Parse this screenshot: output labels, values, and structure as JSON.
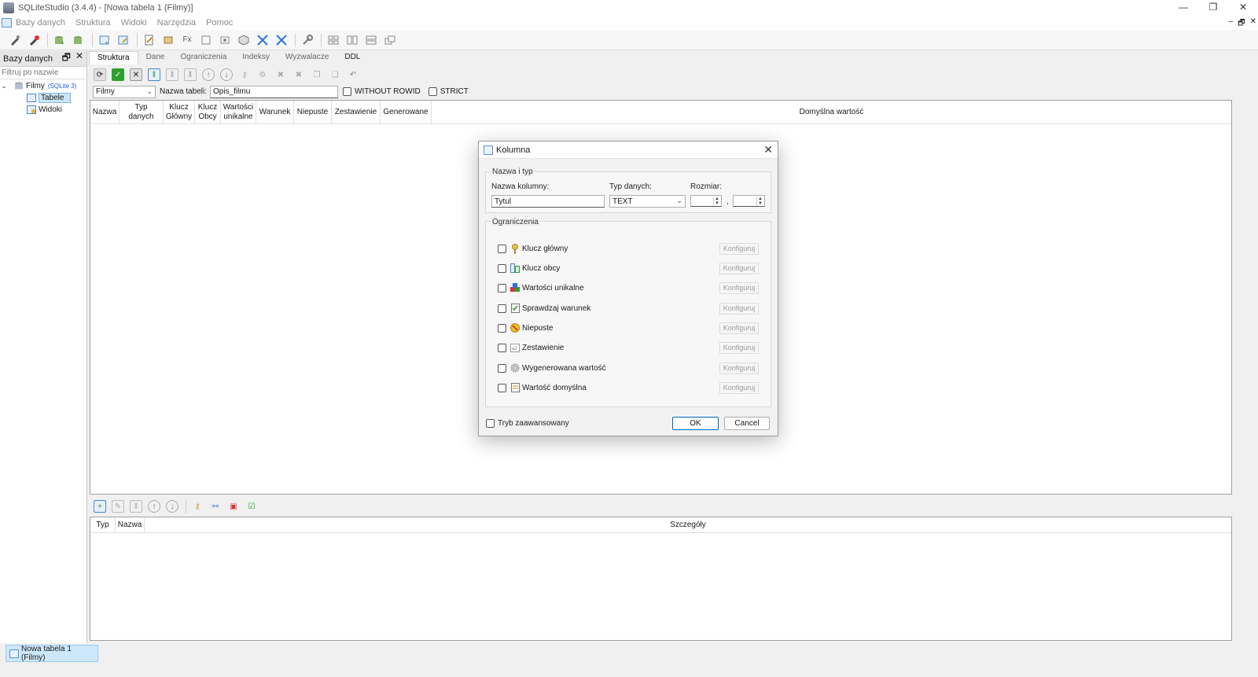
{
  "window": {
    "title": "SQLiteStudio (3.4.4) - [Nowa tabela 1 (Filmy)]",
    "min": "—",
    "max": "❐",
    "close": "✕"
  },
  "menubar": {
    "items": [
      "Bazy danych",
      "Struktura",
      "Widoki",
      "Narzędzia",
      "Pomoc"
    ],
    "mdi_min": "–",
    "mdi_restore": "🗗",
    "mdi_close": "✕"
  },
  "db_panel": {
    "title": "Bazy danych",
    "filter_placeholder": "Filtruj po nazwie",
    "db_name": "Filmy",
    "db_tag": "(SQLite 3)",
    "tables_label": "Tabele",
    "views_label": "Widoki"
  },
  "tabs": [
    "Struktura",
    "Dane",
    "Ograniczenia",
    "Indeksy",
    "Wyzwalacze",
    "DDL"
  ],
  "structure": {
    "db_select": "Filmy",
    "table_name_label": "Nazwa tabeli:",
    "table_name_value": "Opis_filmu",
    "without_rowid": "WITHOUT ROWID",
    "strict": "STRICT"
  },
  "columns_grid": {
    "headers": [
      "Nazwa",
      "Typ danych",
      "Klucz Główny",
      "Klucz Obcy",
      "Wartości unikalne",
      "Warunek",
      "Niepuste",
      "Zestawienie",
      "Generowane",
      "Domyślna wartość"
    ]
  },
  "constraints_grid": {
    "headers": [
      "Typ",
      "Nazwa",
      "Szczegóły"
    ]
  },
  "statusbar": {
    "task_tab": "Nowa tabela 1 (Filmy)"
  },
  "dialog": {
    "title": "Kolumna",
    "group_name_type": "Nazwa i typ",
    "column_name_label": "Nazwa kolumny:",
    "column_name_value": "Tytul",
    "data_type_label": "Typ danych:",
    "data_type_value": "TEXT",
    "size_label": "Rozmiar:",
    "size_sep": ",",
    "group_constraints": "Ograniczenia",
    "constraints": [
      {
        "label": "Klucz główny",
        "icon": "key-icon"
      },
      {
        "label": "Klucz obcy",
        "icon": "foreign-key-icon"
      },
      {
        "label": "Wartości unikalne",
        "icon": "unique-icon"
      },
      {
        "label": "Sprawdzaj warunek",
        "icon": "check-condition-icon"
      },
      {
        "label": "Niepuste",
        "icon": "not-null-icon"
      },
      {
        "label": "Zestawienie",
        "icon": "collation-icon"
      },
      {
        "label": "Wygenerowana wartość",
        "icon": "gear-icon"
      },
      {
        "label": "Wartość domyślna",
        "icon": "default-value-icon"
      }
    ],
    "configure_label": "Konfiguruj",
    "advanced_mode": "Tryb zaawansowany",
    "ok": "OK",
    "cancel": "Cancel"
  }
}
